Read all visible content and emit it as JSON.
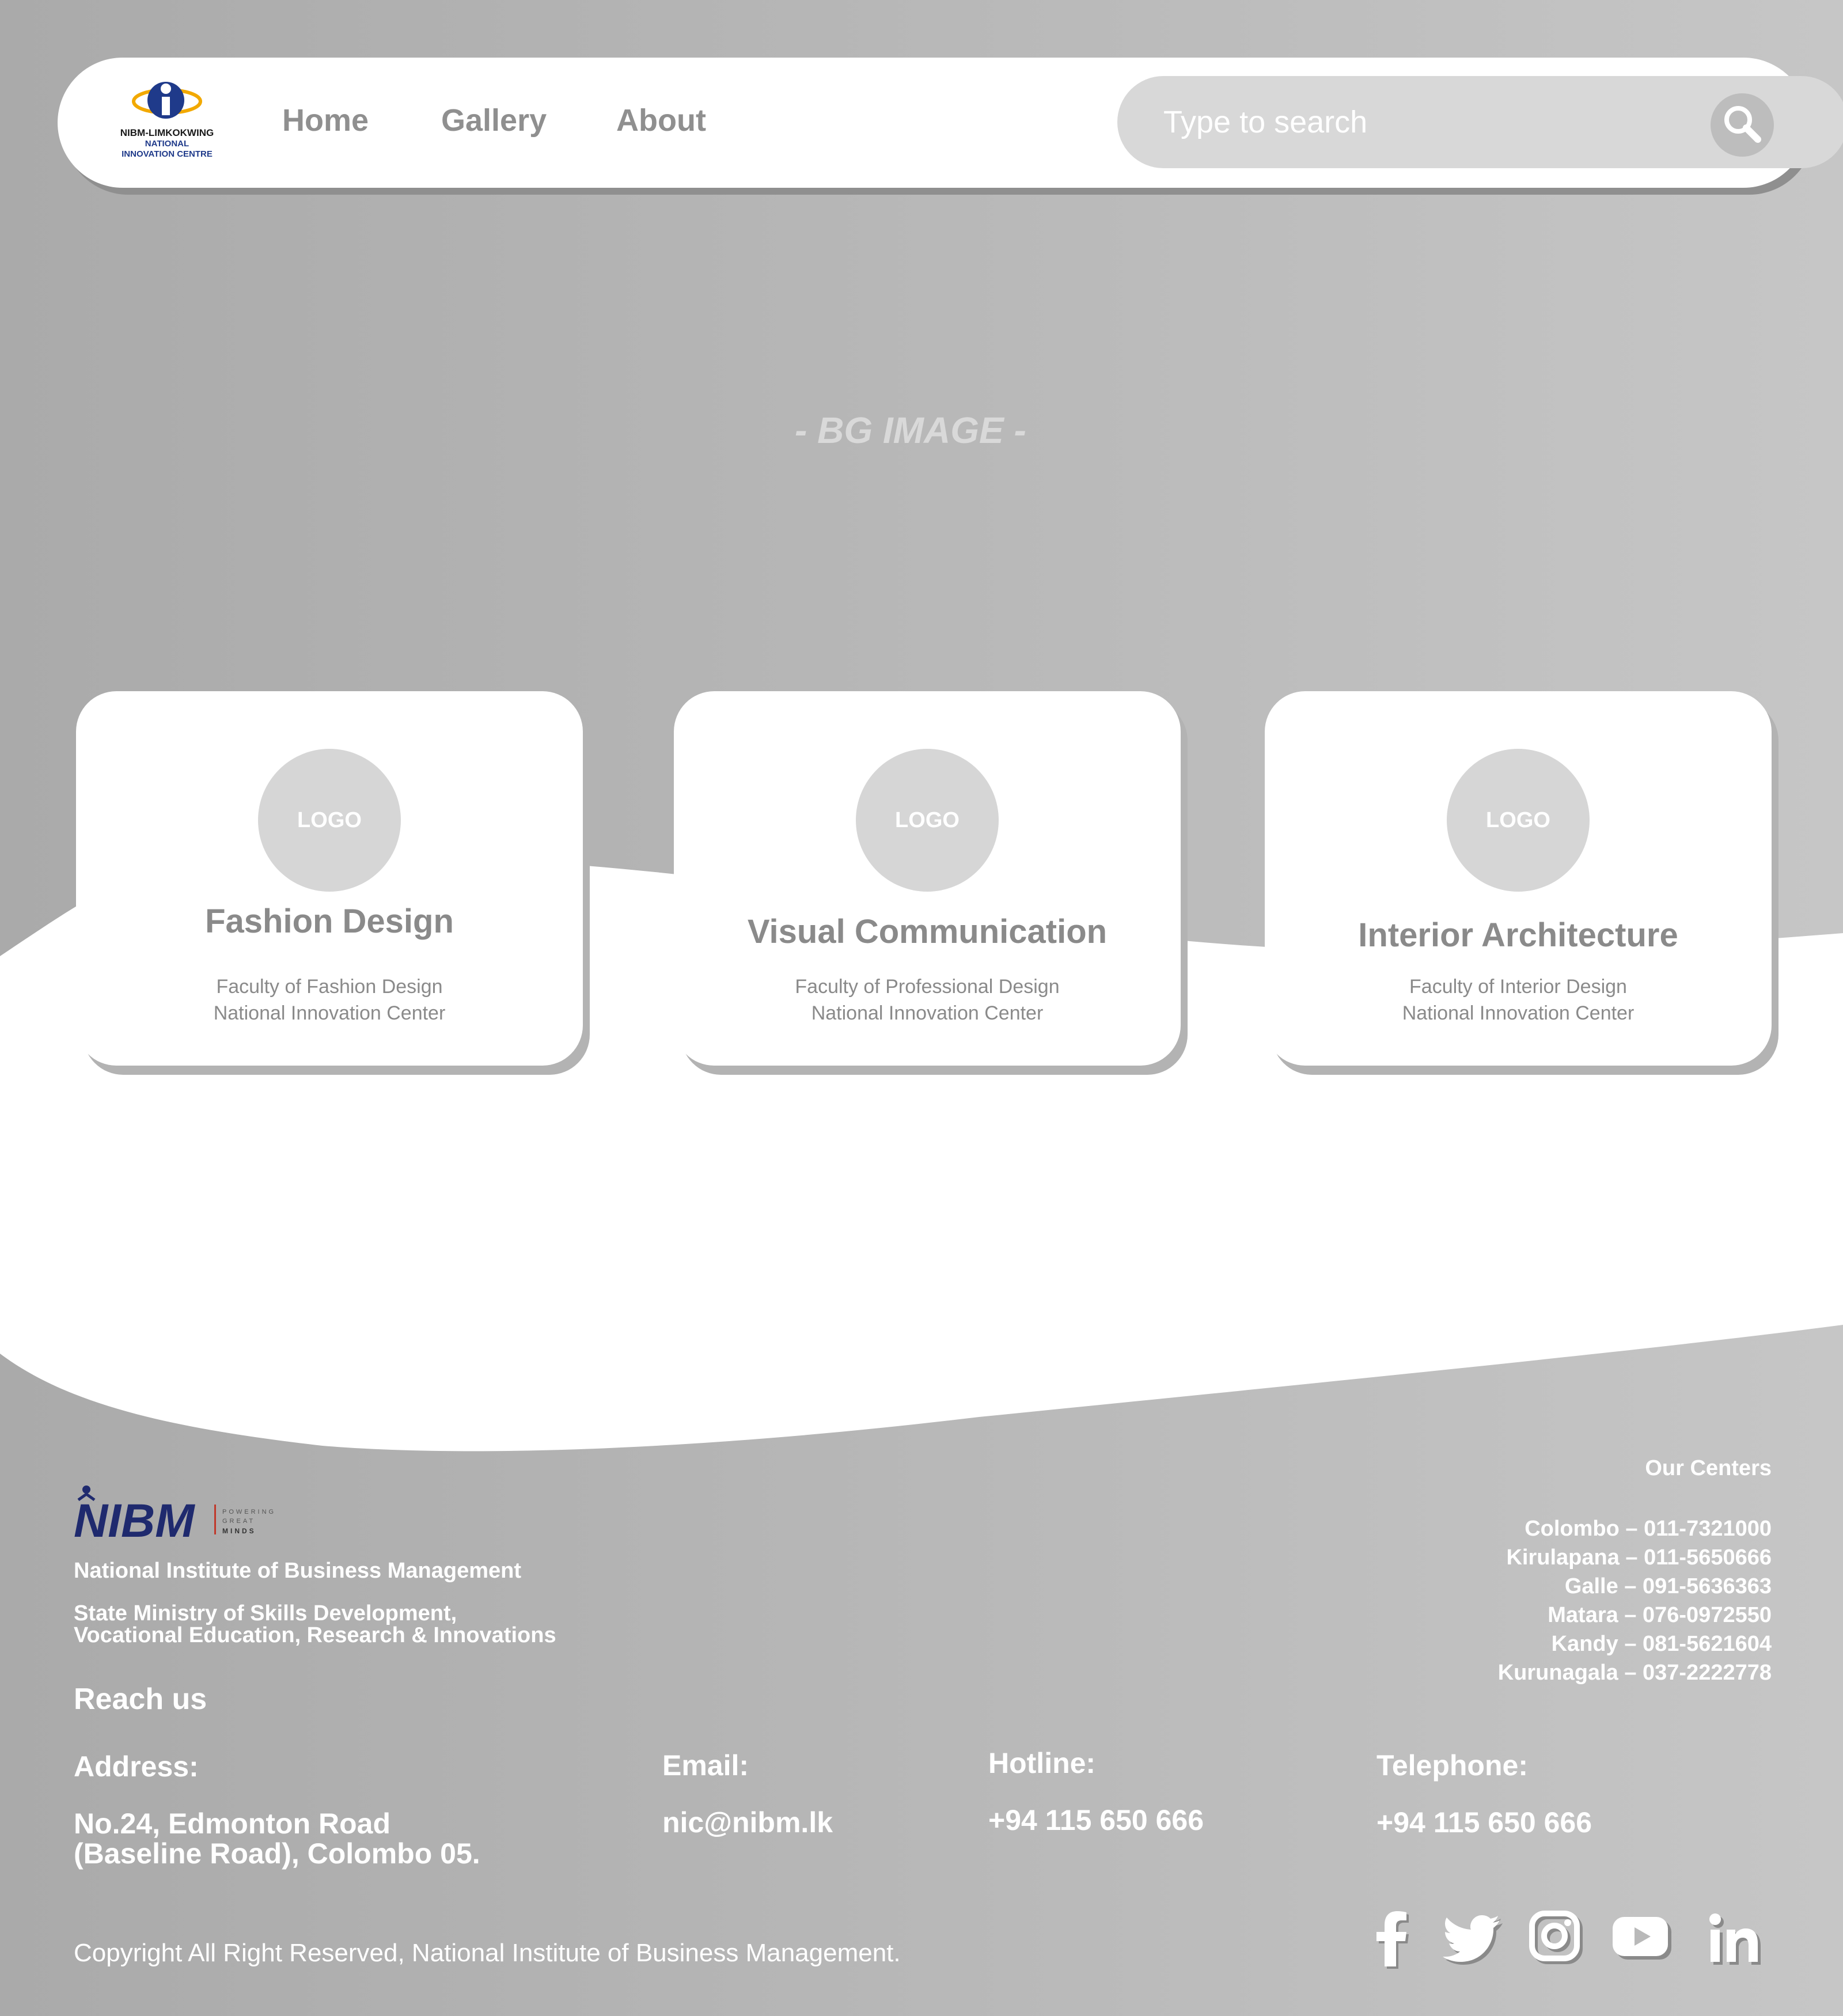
{
  "navbar": {
    "logo_text": [
      "NIBM-LIMKOKWING",
      "NATIONAL",
      "INNOVATION CENTRE"
    ],
    "links": [
      "Home",
      "Gallery",
      "About"
    ],
    "search_placeholder": "Type to search"
  },
  "hero": {
    "bg_label": "- BG IMAGE -"
  },
  "cards": [
    {
      "logo": "LOGO",
      "title": "Fashion Design",
      "line1": "Faculty of Fashion Design",
      "line2": "National Innovation Center"
    },
    {
      "logo": "LOGO",
      "title": "Visual Communication",
      "line1": "Faculty of Professional Design",
      "line2": "National Innovation Center"
    },
    {
      "logo": "LOGO",
      "title": "Interior Architecture",
      "line1": "Faculty of Interior Design",
      "line2": "National Innovation Center"
    }
  ],
  "footer": {
    "nibm_logo_text": "NIBM",
    "nibm_tagline": [
      "POWERING",
      "GREAT",
      "MINDS"
    ],
    "institute": "National Institute of Business Management",
    "ministry_line1": "State Ministry of Skills Development,",
    "ministry_line2": "Vocational Education, Research & Innovations",
    "reach_us": "Reach us",
    "address_label": "Address:",
    "address_line1": "No.24, Edmonton Road",
    "address_line2": "(Baseline Road), Colombo 05.",
    "email_label": "Email:",
    "email": "nic@nibm.lk",
    "hotline_label": "Hotline:",
    "hotline": "+94 115 650 666",
    "telephone_label": "Telephone:",
    "telephone": "+94 115 650 666",
    "copyright": "Copyright All Right Reserved, National Institute of Business Management.",
    "centers_title": "Our Centers",
    "centers": [
      "Colombo – 011-7321000",
      "Kirulapana – 011-5650666",
      "Galle – 091-5636363",
      "Matara – 076-0972550",
      "Kandy – 081-5621604",
      "Kurunagala – 037-2222778"
    ],
    "social_icons": [
      "facebook-icon",
      "twitter-icon",
      "instagram-icon",
      "youtube-icon",
      "linkedin-icon"
    ]
  },
  "colors": {
    "background_gray": "#b5b5b5",
    "card_white": "#ffffff",
    "text_gray": "#8a8a8a",
    "logo_blue": "#1f3a8a",
    "logo_orange": "#f2a900"
  }
}
